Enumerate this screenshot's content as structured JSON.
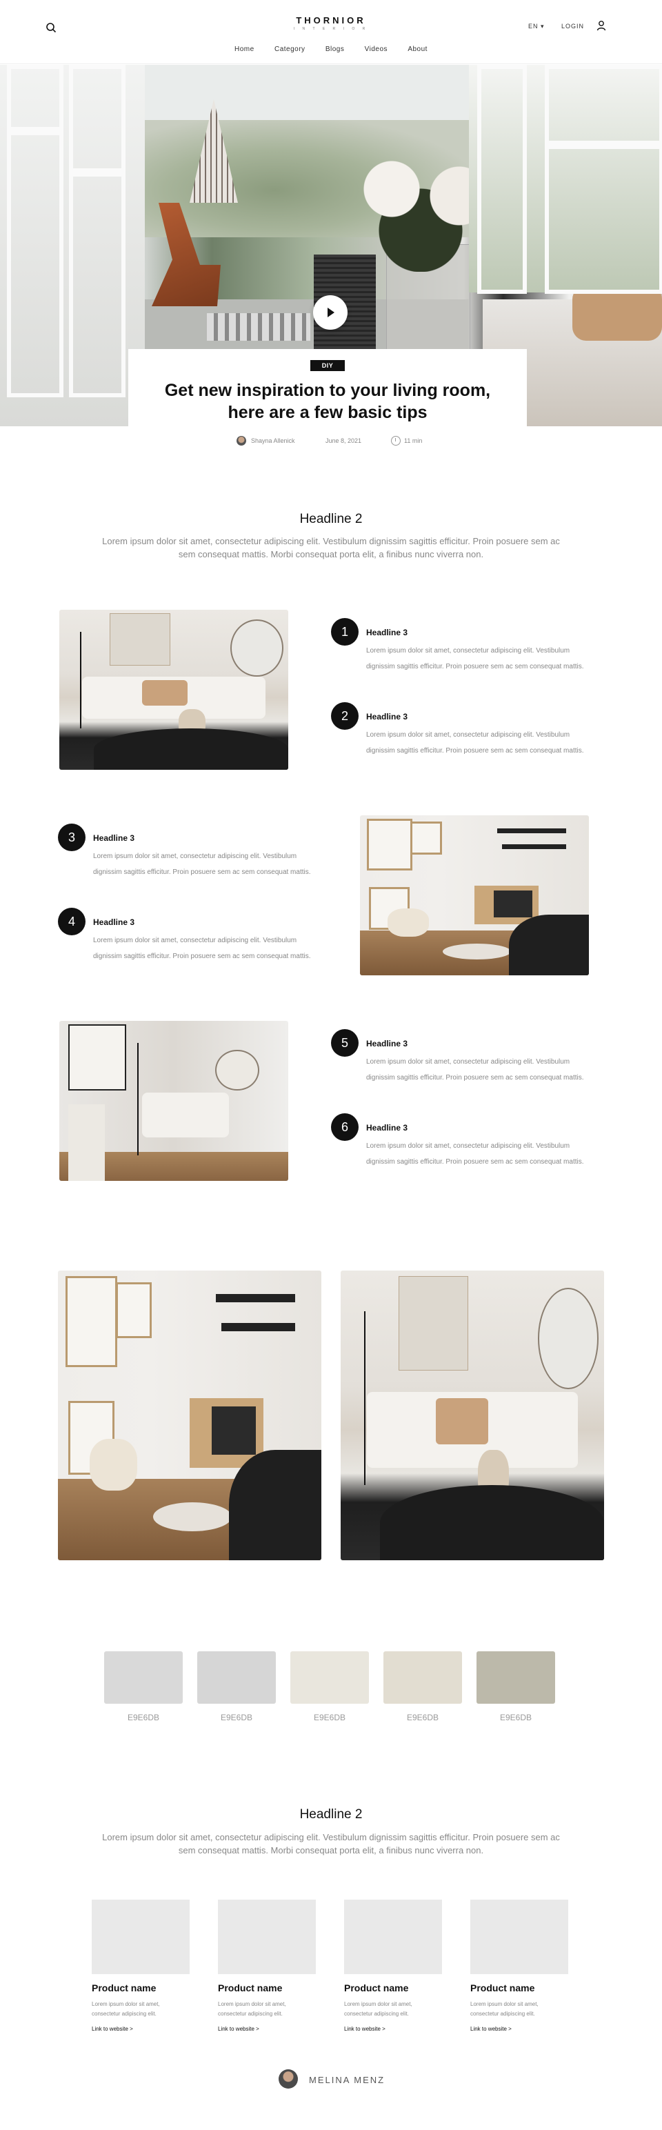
{
  "header": {
    "brand": "THORNIOR",
    "brand_sub": "I N T E R I O R",
    "language": "EN ▾",
    "login": "LOGIN",
    "nav": [
      "Home",
      "Category",
      "Blogs",
      "Videos",
      "About"
    ]
  },
  "article": {
    "tag": "DIY",
    "title": "Get new inspiration to your living room, here are a few basic tips",
    "author": "Shayna Allenick",
    "date": "June 8, 2021",
    "read_time": "11 min"
  },
  "section1": {
    "headline": "Headline 2",
    "lead": "Lorem ipsum dolor sit amet, consectetur adipiscing elit. Vestibulum dignissim sagittis efficitur. Proin posuere sem ac sem consequat mattis. Morbi consequat porta elit, a finibus nunc viverra non."
  },
  "tips": [
    {
      "number": "1",
      "headline": "Headline 3",
      "text": "Lorem ipsum dolor sit amet, consectetur adipiscing elit. Vestibulum dignissim sagittis efficitur. Proin posuere sem ac sem consequat mattis."
    },
    {
      "number": "2",
      "headline": "Headline 3",
      "text": "Lorem ipsum dolor sit amet, consectetur adipiscing elit. Vestibulum dignissim sagittis efficitur. Proin posuere sem ac sem consequat mattis."
    },
    {
      "number": "3",
      "headline": "Headline 3",
      "text": "Lorem ipsum dolor sit amet, consectetur adipiscing elit. Vestibulum dignissim sagittis efficitur. Proin posuere sem ac sem consequat mattis."
    },
    {
      "number": "4",
      "headline": "Headline 3",
      "text": "Lorem ipsum dolor sit amet, consectetur adipiscing elit. Vestibulum dignissim sagittis efficitur. Proin posuere sem ac sem consequat mattis."
    },
    {
      "number": "5",
      "headline": "Headline 3",
      "text": "Lorem ipsum dolor sit amet, consectetur adipiscing elit. Vestibulum dignissim sagittis efficitur. Proin posuere sem ac sem consequat mattis."
    },
    {
      "number": "6",
      "headline": "Headline 3",
      "text": "Lorem ipsum dolor sit amet, consectetur adipiscing elit. Vestibulum dignissim sagittis efficitur. Proin posuere sem ac sem consequat mattis."
    }
  ],
  "palette": [
    {
      "label": "E9E6DB",
      "color": "#d9d9d9"
    },
    {
      "label": "E9E6DB",
      "color": "#d6d6d6"
    },
    {
      "label": "E9E6DB",
      "color": "#e9e6dd"
    },
    {
      "label": "E9E6DB",
      "color": "#e2ddd1"
    },
    {
      "label": "E9E6DB",
      "color": "#bcb9aa"
    }
  ],
  "section2": {
    "headline": "Headline 2",
    "lead": "Lorem ipsum dolor sit amet, consectetur adipiscing elit. Vestibulum dignissim sagittis efficitur. Proin posuere sem ac sem consequat mattis. Morbi consequat porta elit, a finibus nunc viverra non."
  },
  "products": [
    {
      "name": "Product name",
      "desc": "Lorem ipsum dolor sit amet, consectetur adipiscing elit.",
      "link": "Link to website >"
    },
    {
      "name": "Product name",
      "desc": "Lorem ipsum dolor sit amet, consectetur adipiscing elit.",
      "link": "Link to website >"
    },
    {
      "name": "Product name",
      "desc": "Lorem ipsum dolor sit amet, consectetur adipiscing elit.",
      "link": "Link to website >"
    },
    {
      "name": "Product name",
      "desc": "Lorem ipsum dolor sit amet, consectetur adipiscing elit.",
      "link": "Link to website >"
    }
  ],
  "footer": {
    "name": "MELINA MENZ"
  }
}
